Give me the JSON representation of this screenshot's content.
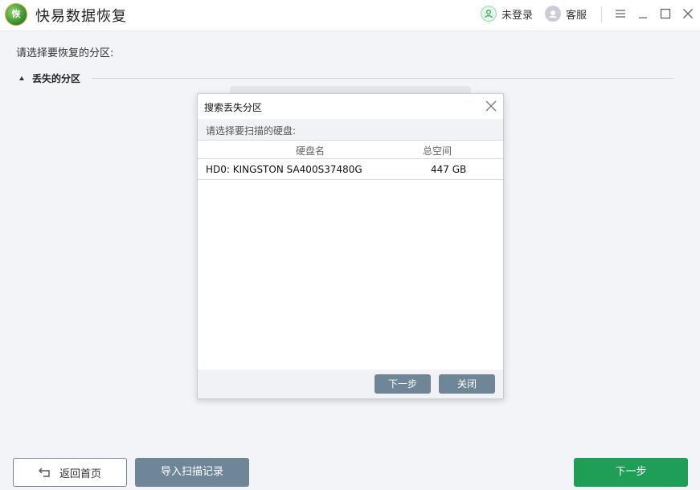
{
  "app": {
    "logo_text": "恢",
    "title": "快易数据恢复"
  },
  "titlebar": {
    "user_label": "未登录",
    "service_label": "客服"
  },
  "main": {
    "prompt": "请选择要恢复的分区:",
    "section_label": "丢失的分区"
  },
  "dialog": {
    "title": "搜索丢失分区",
    "subtitle": "请选择要扫描的硬盘:",
    "columns": {
      "name": "硬盘名",
      "size": "总空间"
    },
    "rows": [
      {
        "name": "HD0: KINGSTON SA400S37480G",
        "size": "447 GB"
      }
    ],
    "next_label": "下一步",
    "close_label": "关闭"
  },
  "footer": {
    "home_label": "返回首页",
    "import_label": "导入扫描记录",
    "next_label": "下一步"
  },
  "colors": {
    "accent_green": "#1f9e57",
    "slate_button": "#6f8598",
    "background": "#f2f4f8"
  },
  "icons": [
    "user-icon",
    "headset-icon",
    "menu-icon",
    "minimize-icon",
    "maximize-icon",
    "close-icon",
    "return-icon",
    "dialog-close-icon"
  ]
}
